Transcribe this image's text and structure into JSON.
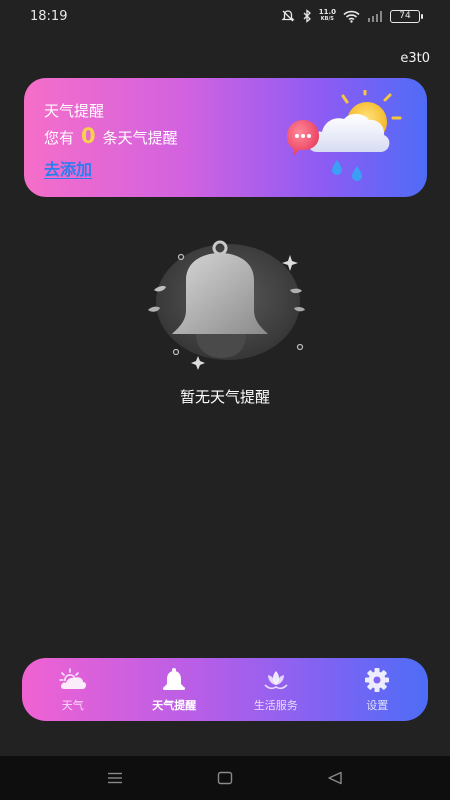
{
  "status_bar": {
    "time": "18:19",
    "net_speed_value": "11.0",
    "net_speed_unit": "KB/S",
    "battery": "74",
    "icons": [
      "mute-icon",
      "bluetooth-icon",
      "wifi-icon",
      "signal-icon"
    ]
  },
  "corner_tag": "e3t0",
  "banner": {
    "title": "天气提醒",
    "prefix": "您有",
    "count": "0",
    "suffix": "条天气提醒",
    "link_label": "去添加",
    "colors": {
      "accent_number": "#f7d24a",
      "link": "#2b7df0"
    }
  },
  "empty_state": {
    "message": "暂无天气提醒",
    "icon": "bell-icon"
  },
  "bottom_nav": {
    "items": [
      {
        "label": "天气",
        "icon": "weather-icon",
        "active": false
      },
      {
        "label": "天气提醒",
        "icon": "bell-icon",
        "active": true
      },
      {
        "label": "生活服务",
        "icon": "lotus-icon",
        "active": false
      },
      {
        "label": "设置",
        "icon": "gear-icon",
        "active": false
      }
    ]
  },
  "system_nav": [
    "menu-icon",
    "home-icon",
    "back-icon"
  ]
}
